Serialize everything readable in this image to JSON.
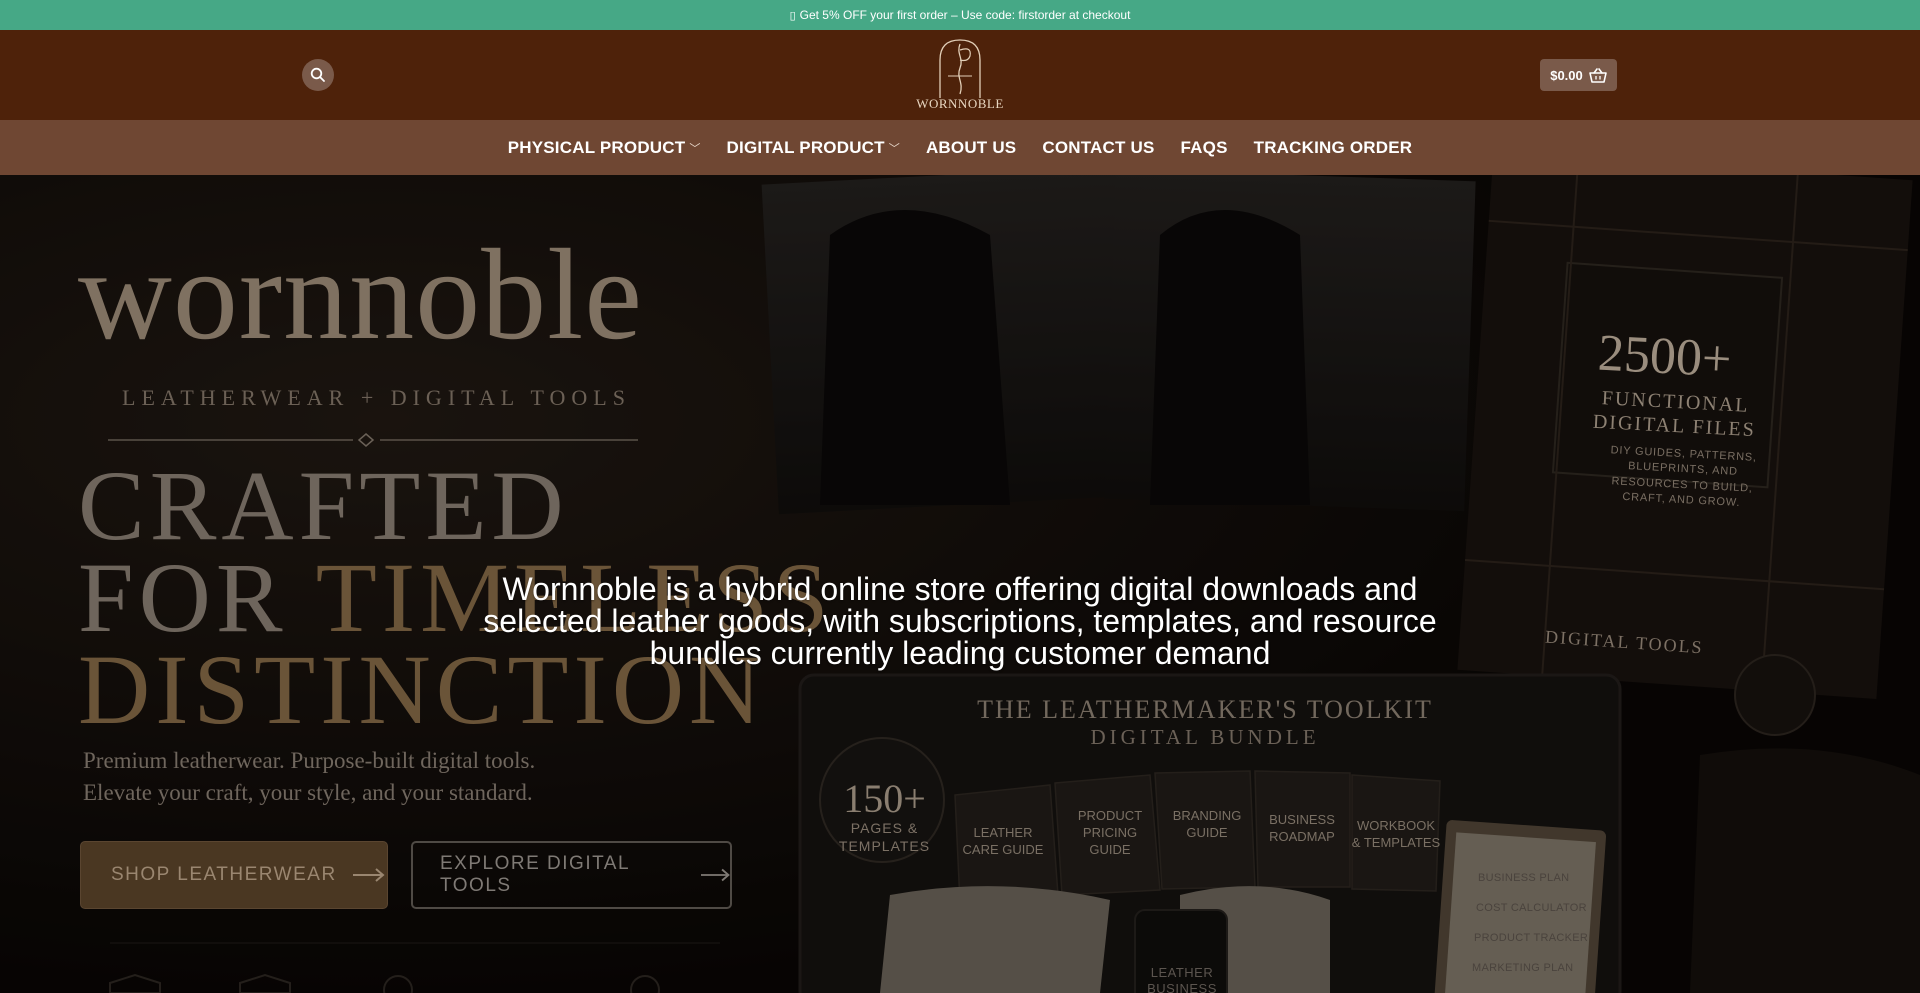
{
  "announcement": {
    "gift_icon": "gift-icon",
    "text": "Get 5% OFF your first order – Use code: firstorder at checkout"
  },
  "header": {
    "logo_text": "WORNNOBLE",
    "cart_total": "$0.00"
  },
  "nav": {
    "items": [
      {
        "label": "PHYSICAL PRODUCT",
        "has_dropdown": true
      },
      {
        "label": "DIGITAL PRODUCT",
        "has_dropdown": true
      },
      {
        "label": "ABOUT US",
        "has_dropdown": false
      },
      {
        "label": "CONTACT US",
        "has_dropdown": false
      },
      {
        "label": "FAQS",
        "has_dropdown": false
      },
      {
        "label": "TRACKING ORDER",
        "has_dropdown": false
      }
    ]
  },
  "hero": {
    "overlay_text": "Wornnoble is a hybrid online store offering digital downloads and selected leather goods, with subscriptions, templates, and resource bundles currently leading customer demand",
    "image": {
      "brand": "wornnoble",
      "tagline": "LEATHERWEAR + DIGITAL TOOLS",
      "headline_1": "CRAFTED",
      "headline_2a": "FOR ",
      "headline_2b": "TIMELESS",
      "headline_3": "DISTINCTION",
      "subline_1": "Premium leatherwear. Purpose-built digital tools.",
      "subline_2": "Elevate your craft, your style, and your standard.",
      "btn_shop": "SHOP LEATHERWEAR",
      "btn_explore": "EXPLORE DIGITAL TOOLS",
      "files_count": "2500+",
      "files_label": "FUNCTIONAL DIGITAL FILES",
      "files_desc": "DIY GUIDES, PATTERNS, BLUEPRINTS, AND RESOURCES TO BUILD, CRAFT, AND GROW.",
      "digital_tools": "DIGITAL TOOLS",
      "toolkit_title": "THE LEATHERMAKER'S TOOLKIT",
      "toolkit_sub": "DIGITAL BUNDLE",
      "pages_count": "150+",
      "pages_label": "PAGES & TEMPLATES",
      "cards": [
        "LEATHER CARE GUIDE",
        "PRODUCT PRICING GUIDE",
        "BRANDING GUIDE",
        "BUSINESS ROADMAP",
        "WORKBOOK & TEMPLATES"
      ],
      "clipboard": [
        "BUSINESS PLAN",
        "COST CALCULATOR",
        "PRODUCT TRACKER",
        "MARKETING PLAN"
      ],
      "phone": "LEATHER BUSINESS"
    }
  },
  "colors": {
    "announcement_bg": "#46a886",
    "header_bg": "#4e220a",
    "nav_bg": "#6f4733",
    "button_bg": "#7a5a4a"
  }
}
